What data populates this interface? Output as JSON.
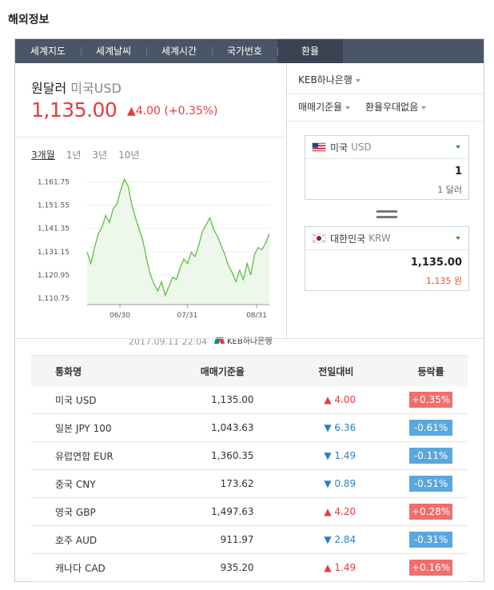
{
  "section_title": "해외정보",
  "tabs": [
    "세계지도",
    "세계날씨",
    "세계시간",
    "국가번호",
    "환율"
  ],
  "active_tab": 4,
  "headline": {
    "name": "원달러",
    "sub": "미국USD",
    "value": "1,135.00",
    "change": "▲4.00 (+0.35%)"
  },
  "periods": [
    "3개월",
    "1년",
    "3년",
    "10년"
  ],
  "active_period": 0,
  "chart_data": {
    "type": "line",
    "x": [
      "06/30",
      "07/31",
      "08/31"
    ],
    "yticks": [
      "1,161.75",
      "1,151.55",
      "1,141.35",
      "1,131.15",
      "1,120.95",
      "1,110.75"
    ],
    "ylim": [
      1108,
      1164
    ],
    "values": [
      1131,
      1126,
      1133,
      1139,
      1142,
      1147,
      1144,
      1150,
      1152,
      1158,
      1163,
      1160,
      1152,
      1146,
      1141,
      1136,
      1128,
      1121,
      1117,
      1114,
      1118,
      1112,
      1116,
      1120,
      1119,
      1124,
      1128,
      1126,
      1131,
      1129,
      1134,
      1140,
      1143,
      1146,
      1141,
      1138,
      1134,
      1130,
      1125,
      1122,
      1118,
      1123,
      1119,
      1126,
      1121,
      1130,
      1133,
      1132,
      1135,
      1139
    ],
    "color": "#5cbf47",
    "fill": "#edf7ea"
  },
  "timestamp": "2017.09.11 22:04",
  "bank_logo": "KEB하나은행",
  "bank_select": "KEB하나은행",
  "option1": "매매기준율",
  "option2": "환율우대없음",
  "from": {
    "country": "미국",
    "code": "USD",
    "amount": "1",
    "unit": "1 달러"
  },
  "to": {
    "country": "대한민국",
    "code": "KRW",
    "amount": "1,135.00",
    "unit": "1,135 원"
  },
  "table": {
    "headers": [
      "통화명",
      "매매기준율",
      "전일대비",
      "등락률"
    ],
    "rows": [
      {
        "country": "미국",
        "code": "USD",
        "rate": "1,135.00",
        "change": "▲ 4.00",
        "pct": "+0.35%",
        "dir": "up"
      },
      {
        "country": "일본",
        "code": "JPY 100",
        "rate": "1,043.63",
        "change": "▼ 6.36",
        "pct": "-0.61%",
        "dir": "down"
      },
      {
        "country": "유럽연합",
        "code": "EUR",
        "rate": "1,360.35",
        "change": "▼ 1.49",
        "pct": "-0.11%",
        "dir": "down"
      },
      {
        "country": "중국",
        "code": "CNY",
        "rate": "173.62",
        "change": "▼ 0.89",
        "pct": "-0.51%",
        "dir": "down"
      },
      {
        "country": "영국",
        "code": "GBP",
        "rate": "1,497.63",
        "change": "▲ 4.20",
        "pct": "+0.28%",
        "dir": "up"
      },
      {
        "country": "호주",
        "code": "AUD",
        "rate": "911.97",
        "change": "▼ 2.84",
        "pct": "-0.31%",
        "dir": "down"
      },
      {
        "country": "캐나다",
        "code": "CAD",
        "rate": "935.20",
        "change": "▲ 1.49",
        "pct": "+0.16%",
        "dir": "up"
      }
    ]
  },
  "colors": {
    "up": "#e63b3b",
    "down": "#2d7fc4",
    "tab_bg": "#4a5566"
  }
}
